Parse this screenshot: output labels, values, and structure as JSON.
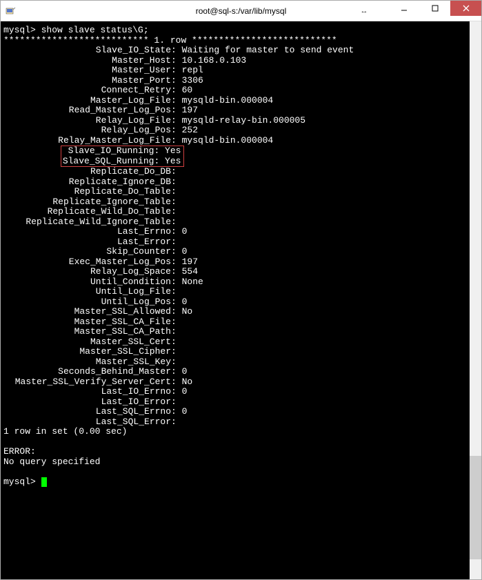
{
  "window": {
    "title": "root@sql-s:/var/lib/mysql"
  },
  "terminal": {
    "prompt": "mysql>",
    "command": "show slave status\\G;",
    "row_header": "*************************** 1. row ***************************",
    "fields": [
      {
        "key": "Slave_IO_State",
        "val": "Waiting for master to send event"
      },
      {
        "key": "Master_Host",
        "val": "10.168.0.103"
      },
      {
        "key": "Master_User",
        "val": "repl"
      },
      {
        "key": "Master_Port",
        "val": "3306"
      },
      {
        "key": "Connect_Retry",
        "val": "60"
      },
      {
        "key": "Master_Log_File",
        "val": "mysqld-bin.000004"
      },
      {
        "key": "Read_Master_Log_Pos",
        "val": "197"
      },
      {
        "key": "Relay_Log_File",
        "val": "mysqld-relay-bin.000005"
      },
      {
        "key": "Relay_Log_Pos",
        "val": "252"
      },
      {
        "key": "Relay_Master_Log_File",
        "val": "mysqld-bin.000004"
      }
    ],
    "highlighted": [
      {
        "key": "Slave_IO_Running",
        "val": "Yes"
      },
      {
        "key": "Slave_SQL_Running",
        "val": "Yes"
      }
    ],
    "fields2": [
      {
        "key": "Replicate_Do_DB",
        "val": ""
      },
      {
        "key": "Replicate_Ignore_DB",
        "val": ""
      },
      {
        "key": "Replicate_Do_Table",
        "val": ""
      },
      {
        "key": "Replicate_Ignore_Table",
        "val": ""
      },
      {
        "key": "Replicate_Wild_Do_Table",
        "val": ""
      },
      {
        "key": "Replicate_Wild_Ignore_Table",
        "val": ""
      },
      {
        "key": "Last_Errno",
        "val": "0"
      },
      {
        "key": "Last_Error",
        "val": ""
      },
      {
        "key": "Skip_Counter",
        "val": "0"
      },
      {
        "key": "Exec_Master_Log_Pos",
        "val": "197"
      },
      {
        "key": "Relay_Log_Space",
        "val": "554"
      },
      {
        "key": "Until_Condition",
        "val": "None"
      },
      {
        "key": "Until_Log_File",
        "val": ""
      },
      {
        "key": "Until_Log_Pos",
        "val": "0"
      },
      {
        "key": "Master_SSL_Allowed",
        "val": "No"
      },
      {
        "key": "Master_SSL_CA_File",
        "val": ""
      },
      {
        "key": "Master_SSL_CA_Path",
        "val": ""
      },
      {
        "key": "Master_SSL_Cert",
        "val": ""
      },
      {
        "key": "Master_SSL_Cipher",
        "val": ""
      },
      {
        "key": "Master_SSL_Key",
        "val": ""
      },
      {
        "key": "Seconds_Behind_Master",
        "val": "0"
      },
      {
        "key": "Master_SSL_Verify_Server_Cert",
        "val": "No"
      },
      {
        "key": "Last_IO_Errno",
        "val": "0"
      },
      {
        "key": "Last_IO_Error",
        "val": ""
      },
      {
        "key": "Last_SQL_Errno",
        "val": "0"
      },
      {
        "key": "Last_SQL_Error",
        "val": ""
      }
    ],
    "footer_row": "1 row in set (0.00 sec)",
    "error_label": "ERROR:",
    "error_msg": "No query specified"
  }
}
